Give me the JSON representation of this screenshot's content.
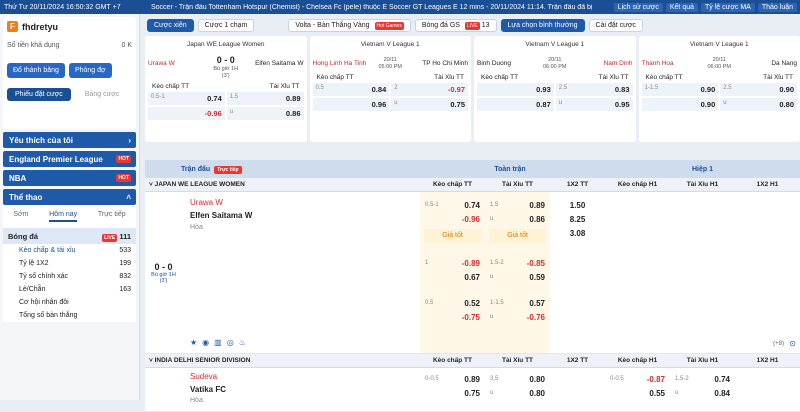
{
  "topbar": {
    "datetime": "Thứ Tư 20/11/2024 16:50:32 GMT +7",
    "ticker": "Soccer - Trận đấu Tottenham Hotspur (Chemist) - Chelsea Fc (pele) thuộc E Soccer GT Leagues E 12 mins - 20/11/2024 11:14. Trận đấu đã bị",
    "history": "Lịch sử cược",
    "result": "Kết quả",
    "odds_type": "Tỷ lệ cược MA",
    "discuss": "Thảo luận"
  },
  "account": {
    "username": "fhdretyu",
    "balance_label": "Số tiền khả dụng",
    "balance": "0 K",
    "deposit": "Đổ thành băng",
    "room": "Phòng đợ",
    "tab_bet_slip": "Phiếu đặt cược",
    "tab_board": "Bảng cược"
  },
  "sidebar": {
    "favorites": "Yêu thích của tôi",
    "leagues": [
      {
        "name": "England Premier League",
        "badge": "HOT"
      },
      {
        "name": "NBA",
        "badge": "HOT"
      }
    ],
    "sports_header": "Thể thao",
    "tabs": [
      "Sớm",
      "Hôm nay",
      "Trực tiếp"
    ],
    "sport": {
      "name": "Bóng đá",
      "badge": "LIVE",
      "count": "111"
    },
    "subs": [
      {
        "name": "Kèo chấp & tài xỉu",
        "count": "533"
      },
      {
        "name": "Tỷ lệ 1X2",
        "count": "199"
      },
      {
        "name": "Tỷ số chính xác",
        "count": "832"
      },
      {
        "name": "Lẻ/Chẵn",
        "count": "163"
      },
      {
        "name": "Cơ hội nhân đôi",
        "count": ""
      },
      {
        "name": "Tổng số bàn thắng",
        "count": ""
      }
    ]
  },
  "toolbar": {
    "parlay": "Cược xiên",
    "single": "Cược 1 chạm",
    "volta": "Volta - Bàn Thắng Vàng",
    "volta_badge": "Hot Games",
    "gs": "Bóng đá GS",
    "gs_badge": "LIVE",
    "gs_count": "13",
    "sort": "Lựa chọn bình thường",
    "settings": "Cài đặt cược"
  },
  "cards": [
    {
      "league": "Japan WE League Women",
      "home": "Urawa W",
      "away": "Elfen Saitama W",
      "score": "0 - 0",
      "time": "Bù giờ 1H",
      "sub": "(3')",
      "h1": "0.5-1",
      "o1": "0.74",
      "o2l": "1.5",
      "o2": "0.89",
      "r1": "-0.96",
      "r2l": "u",
      "r2": "0.86"
    },
    {
      "league": "Vietnam V League 1",
      "home": "Hong Linh Ha Tinh",
      "away": "TP Ho Chi Minh",
      "score": "",
      "time": "20/11",
      "sub": "05:00 PM",
      "h1": "0.5",
      "o1": "0.84",
      "o2l": "2",
      "o2": "-0.97",
      "r1": "0.96",
      "r2l": "u",
      "r2": "0.75"
    },
    {
      "league": "Vietnam V League 1",
      "home": "Binh Duong",
      "away": "Nam Dinh",
      "score": "",
      "time": "20/11",
      "sub": "06:00 PM",
      "h1": "",
      "o1": "0.93",
      "o2l": "2.5",
      "o2": "0.83",
      "r1": "0.87",
      "r2l": "u",
      "r2": "0.95"
    },
    {
      "league": "Vietnam V League 1",
      "home": "Thanh Hoa",
      "away": "Da Nang",
      "score": "",
      "time": "20/11",
      "sub": "06:00 PM",
      "h1": "1-1.5",
      "o1": "0.90",
      "o2l": "2.5",
      "o2": "0.90",
      "r1": "0.90",
      "r2l": "u",
      "r2": "0.80"
    }
  ],
  "card_labels": {
    "handicap": "Kèo chấp TT",
    "ou": "Tài Xỉu TT"
  },
  "table_head": {
    "match": "Trận đấu",
    "live_tag": "Trực tiếp",
    "full": "Toàn trận",
    "half": "Hiệp 1"
  },
  "cols": {
    "hcap": "Kèo chấp TT",
    "ou": "Tài Xỉu TT",
    "x12": "1X2 TT",
    "hcap1": "Kèo chấp H1",
    "ou1": "Tài Xỉu H1",
    "x121": "1X2 H1"
  },
  "leagues": [
    {
      "name": "JAPAN WE LEAGUE WOMEN",
      "home": "Urawa W",
      "away": "Elfen Saitama W",
      "draw": "Hòa",
      "score": "0 - 0",
      "time": "Bù giờ 1H",
      "sub": "(3')",
      "rows": [
        {
          "hl": "0.5-1",
          "h": "0.74",
          "ol": "1.5",
          "o": "0.89",
          "hr": "-0.96",
          "orl": "u",
          "or": "0.86",
          "x": [
            "1.50",
            "8.25",
            "3.08"
          ]
        },
        {
          "hl": "1",
          "h": "-0.89",
          "ol": "1.5-2",
          "o": "-0.85",
          "hr": "0.67",
          "orl": "u",
          "or": "0.59"
        },
        {
          "hl": "0.5",
          "h": "0.52",
          "ol": "1-1.5",
          "o": "0.57",
          "hr": "-0.75",
          "orl": "u",
          "or": "-0.76"
        }
      ],
      "good": "Giá tốt",
      "more": "(+8)"
    },
    {
      "name": "INDIA DELHI SENIOR DIVISION",
      "home": "Sudeva",
      "away": "Vatika FC",
      "draw": "Hòa",
      "row": {
        "hl": "0-0.5",
        "h": "0.89",
        "ol": "3.5",
        "o": "0.80",
        "hr": "0.75",
        "orl": "u",
        "or": "0.80",
        "h1l": "0-0.5",
        "h1": "-0.87",
        "o1l": "1.5-2",
        "o1": "0.74",
        "h1r": "0.55",
        "o1rl": "u",
        "o1r": "0.84"
      }
    }
  ],
  "colors": {
    "brand": "#1b4f95",
    "accent": "#e07b00",
    "negative": "#d32f2f"
  }
}
